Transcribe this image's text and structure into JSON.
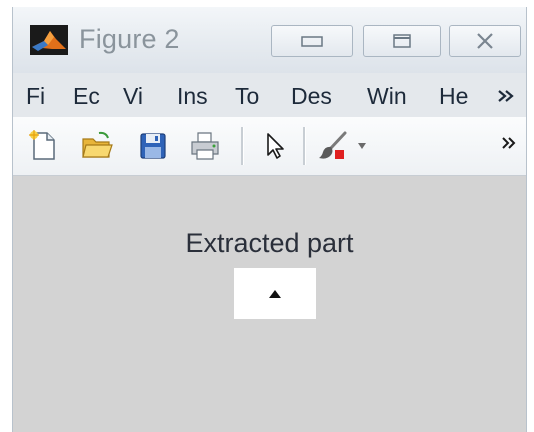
{
  "window": {
    "title": "Figure 2",
    "controls": [
      "minimize",
      "maximize",
      "close"
    ]
  },
  "menubar": {
    "items": [
      "Fi",
      "Ec",
      "Vi",
      "Ins",
      "To",
      "Des",
      "Win",
      "He"
    ],
    "overflow_icon": "double-chevron-right-icon"
  },
  "toolbar": {
    "tools": [
      {
        "name": "new-figure",
        "icon": "new-file-icon"
      },
      {
        "name": "open-file",
        "icon": "open-folder-icon"
      },
      {
        "name": "save-figure",
        "icon": "save-disk-icon"
      },
      {
        "name": "print-figure",
        "icon": "printer-icon"
      },
      {
        "name": "edit-plot",
        "icon": "cursor-arrow-icon"
      },
      {
        "name": "brush-data",
        "icon": "brush-icon"
      }
    ],
    "overflow_label": "»"
  },
  "figure": {
    "panel_title": "Extracted part",
    "popup_control": {
      "icon": "triangle-up-icon"
    }
  },
  "colors": {
    "canvas_background": "#d3d3d3",
    "title_text": "#8a949c",
    "menu_text": "#1d2a3a",
    "accent_red": "#e02020"
  }
}
